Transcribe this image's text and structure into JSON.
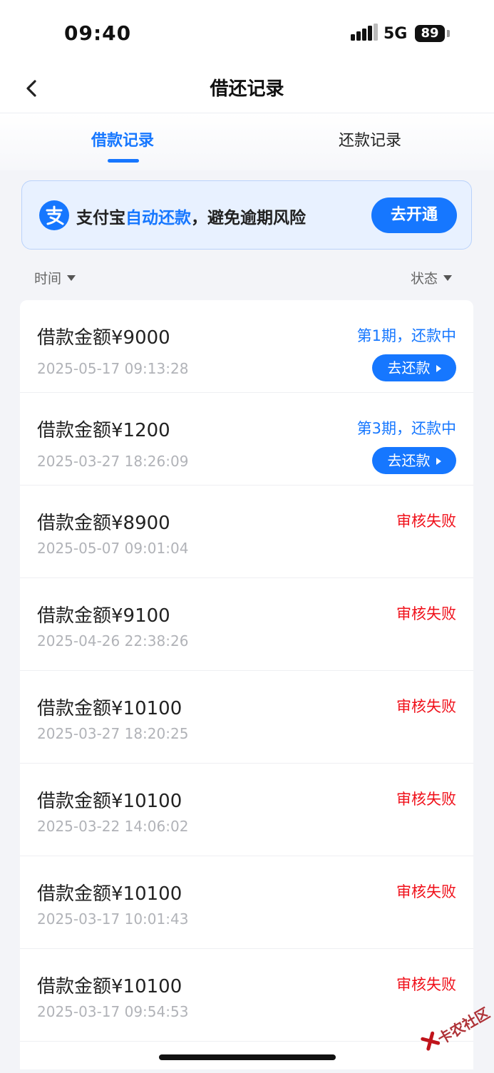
{
  "status_bar": {
    "time": "09:40",
    "network": "5G",
    "battery": "89"
  },
  "header": {
    "title": "借还记录",
    "back_icon": "chevron-left-icon"
  },
  "tabs": [
    {
      "label": "借款记录",
      "active": true
    },
    {
      "label": "还款记录",
      "active": false
    }
  ],
  "banner": {
    "prefix": "支付宝",
    "highlight": "自动还款",
    "suffix": "，避免逾期风险",
    "button": "去开通",
    "logo_icon": "alipay-icon"
  },
  "filters": {
    "time": "时间",
    "status": "状态"
  },
  "records": [
    {
      "amount": "借款金额¥9000",
      "date": "2025-05-17 09:13:28",
      "status": "第1期，还款中",
      "status_type": "repaying",
      "button": "去还款"
    },
    {
      "amount": "借款金额¥1200",
      "date": "2025-03-27 18:26:09",
      "status": "第3期，还款中",
      "status_type": "repaying",
      "button": "去还款"
    },
    {
      "amount": "借款金额¥8900",
      "date": "2025-05-07 09:01:04",
      "status": "审核失败",
      "status_type": "failed"
    },
    {
      "amount": "借款金额¥9100",
      "date": "2025-04-26 22:38:26",
      "status": "审核失败",
      "status_type": "failed"
    },
    {
      "amount": "借款金额¥10100",
      "date": "2025-03-27 18:20:25",
      "status": "审核失败",
      "status_type": "failed"
    },
    {
      "amount": "借款金额¥10100",
      "date": "2025-03-22 14:06:02",
      "status": "审核失败",
      "status_type": "failed"
    },
    {
      "amount": "借款金额¥10100",
      "date": "2025-03-17 10:01:43",
      "status": "审核失败",
      "status_type": "failed"
    },
    {
      "amount": "借款金额¥10100",
      "date": "2025-03-17 09:54:53",
      "status": "审核失败",
      "status_type": "failed"
    }
  ],
  "watermark": {
    "text": "卡农社区"
  },
  "colors": {
    "accent": "#1677ff",
    "failed": "#f0101a",
    "muted": "#b1b3b8"
  }
}
